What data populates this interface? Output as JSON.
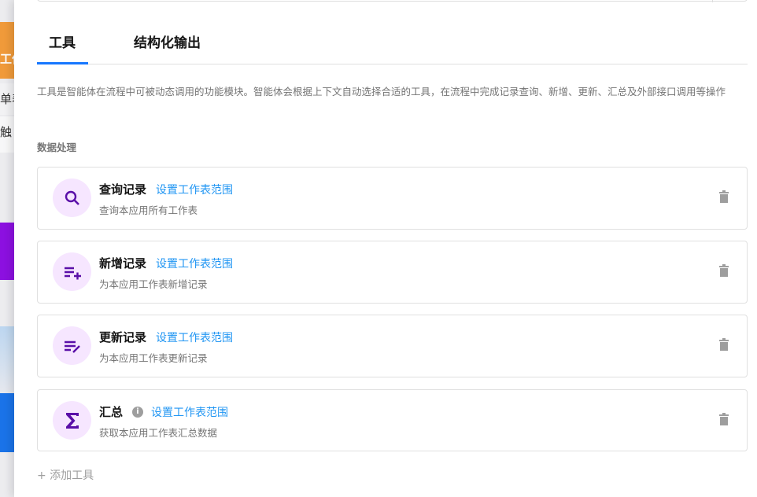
{
  "background": {
    "fragments": [
      "工作",
      "单表",
      "触"
    ]
  },
  "tabs": [
    {
      "label": "工具",
      "active": true
    },
    {
      "label": "结构化输出",
      "active": false
    }
  ],
  "description": "工具是智能体在流程中可被动态调用的功能模块。智能体会根据上下文自动选择合适的工具，在流程中完成记录查询、新增、更新、汇总及外部接口调用等操作",
  "section_title": "数据处理",
  "tools": [
    {
      "name": "查询记录",
      "icon": "search-icon",
      "link": "设置工作表范围",
      "subtitle": "查询本应用所有工作表",
      "info": false
    },
    {
      "name": "新增记录",
      "icon": "list-add-icon",
      "link": "设置工作表范围",
      "subtitle": "为本应用工作表新增记录",
      "info": false
    },
    {
      "name": "更新记录",
      "icon": "list-edit-icon",
      "link": "设置工作表范围",
      "subtitle": "为本应用工作表更新记录",
      "info": false
    },
    {
      "name": "汇总",
      "icon": "sigma-icon",
      "link": "设置工作表范围",
      "subtitle": "获取本应用工作表汇总数据",
      "info": true
    }
  ],
  "add_tool_label": "+ 添加工具",
  "colors": {
    "accent": "#1677ff",
    "link": "#2196f3",
    "icon": "#5a0fa8",
    "icon_bg": "#f6e6ff"
  }
}
